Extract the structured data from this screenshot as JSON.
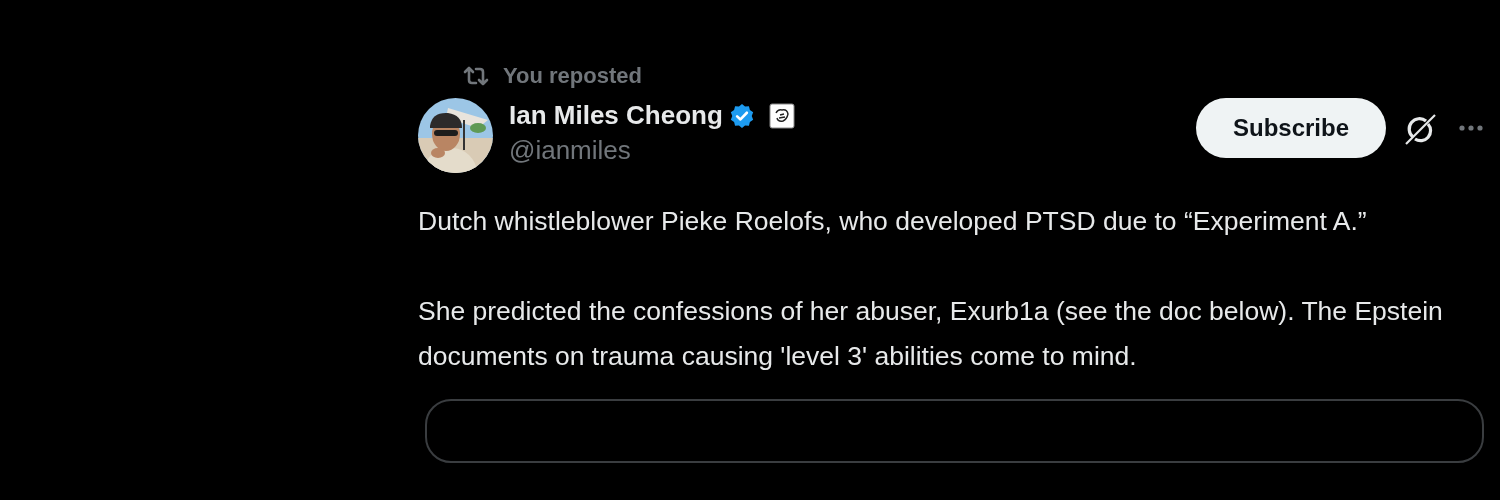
{
  "repost": {
    "label": "You reposted"
  },
  "author": {
    "name": "Ian Miles Cheong",
    "handle": "@ianmiles"
  },
  "subscribe_button": {
    "label": "Subscribe"
  },
  "post": {
    "paragraphs": [
      "Dutch whistleblower Pieke Roelofs, who developed PTSD due to “Experiment A.”",
      "She predicted the confessions of her abuser, Exurb1a (see the doc below). The Epstein documents on trauma causing 'level 3' abilities come to mind."
    ]
  }
}
